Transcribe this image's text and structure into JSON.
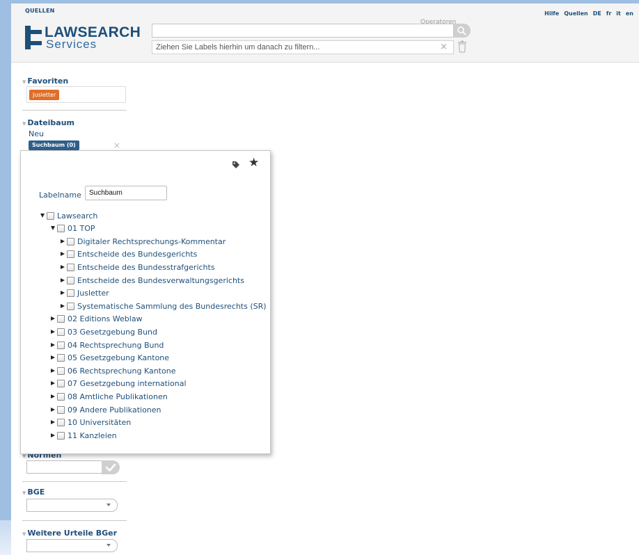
{
  "header": {
    "section_label": "QUELLEN",
    "logo_line1": "LAWSEARCH",
    "logo_line2": "Services",
    "operators_label": "Operatoren",
    "search_value": "",
    "filter_placeholder": "Ziehen Sie Labels hierhin um danach zu filtern...",
    "filter_clear": "×",
    "links": [
      "Hilfe",
      "Quellen",
      "DE",
      "fr",
      "it",
      "en"
    ]
  },
  "sidebar": {
    "favoriten": {
      "title": "Favoriten",
      "tag": "Jusletter"
    },
    "dateibaum": {
      "title": "Dateibaum",
      "neu": "Neu",
      "tag": "Suchbaum (0)",
      "remove": "×"
    },
    "normen": {
      "title": "Normen"
    },
    "bge": {
      "title": "BGE",
      "selected": ""
    },
    "weitere": {
      "title": "Weitere Urteile BGer",
      "selected": ""
    }
  },
  "popup": {
    "labelname_label": "Labelname",
    "labelname_value": "Suchbaum",
    "tree": [
      {
        "label": "Lawsearch",
        "expanded": true
      },
      {
        "label": "01 TOP",
        "expanded": true
      },
      {
        "label": "Digitaler Rechtsprechungs-Kommentar"
      },
      {
        "label": "Entscheide des Bundesgerichts"
      },
      {
        "label": "Entscheide des Bundesstrafgerichts"
      },
      {
        "label": "Entscheide des Bundesverwaltungsgerichts"
      },
      {
        "label": "Jusletter"
      },
      {
        "label": "Systematische Sammlung des Bundesrechts (SR)"
      },
      {
        "label": "02 Editions Weblaw"
      },
      {
        "label": "03 Gesetzgebung Bund"
      },
      {
        "label": "04 Rechtsprechung Bund"
      },
      {
        "label": "05 Gesetzgebung Kantone"
      },
      {
        "label": "06 Rechtsprechung Kantone"
      },
      {
        "label": "07 Gesetzgebung international"
      },
      {
        "label": "08 Amtliche Publikationen"
      },
      {
        "label": "09 Andere Publikationen"
      },
      {
        "label": "10 Universitäten"
      },
      {
        "label": "11 Kanzleien"
      }
    ]
  },
  "colors": {
    "brand": "#1e4f7a",
    "frame": "#9fbfe2",
    "favorite_tag": "#e06e2a",
    "label_tag": "#2f5f8a"
  }
}
